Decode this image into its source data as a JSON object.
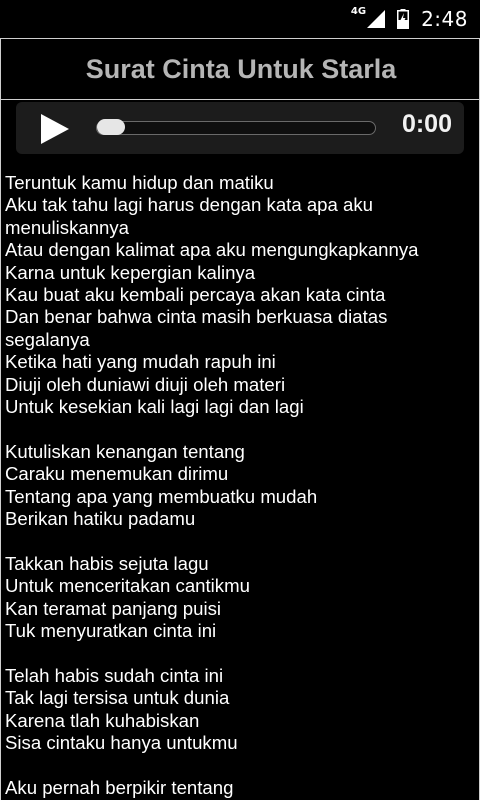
{
  "status_bar": {
    "network_type": "4G",
    "signal_icon": "cell-signal-icon",
    "battery_icon": "battery-icon",
    "time": "2:48"
  },
  "title_bar": {
    "title": "Surat Cinta Untuk Starla"
  },
  "player": {
    "play_icon": "play-icon",
    "position_label": "0:00",
    "progress_fraction": 0
  },
  "lyrics": [
    "Teruntuk kamu hidup dan matiku",
    "Aku tak tahu lagi harus dengan kata apa aku",
    "menuliskannya",
    "Atau dengan kalimat apa aku mengungkapkannya",
    "Karna untuk kepergian kalinya",
    "Kau buat aku kembali percaya akan kata cinta",
    "Dan benar bahwa cinta masih berkuasa diatas",
    "segalanya",
    "Ketika hati yang mudah rapuh ini",
    "Diuji oleh duniawi diuji oleh materi",
    "Untuk kesekian kali lagi lagi dan lagi",
    "",
    "Kutuliskan kenangan tentang",
    "Caraku menemukan dirimu",
    "Tentang apa yang membuatku mudah",
    "Berikan hatiku padamu",
    "",
    "Takkan habis sejuta lagu",
    "Untuk menceritakan cantikmu",
    "Kan teramat panjang puisi",
    "Tuk menyuratkan cinta ini",
    "",
    "Telah habis sudah cinta ini",
    "Tak lagi tersisa untuk dunia",
    "Karena tlah kuhabiskan",
    "Sisa cintaku hanya untukmu",
    "",
    "Aku pernah berpikir tentang"
  ]
}
